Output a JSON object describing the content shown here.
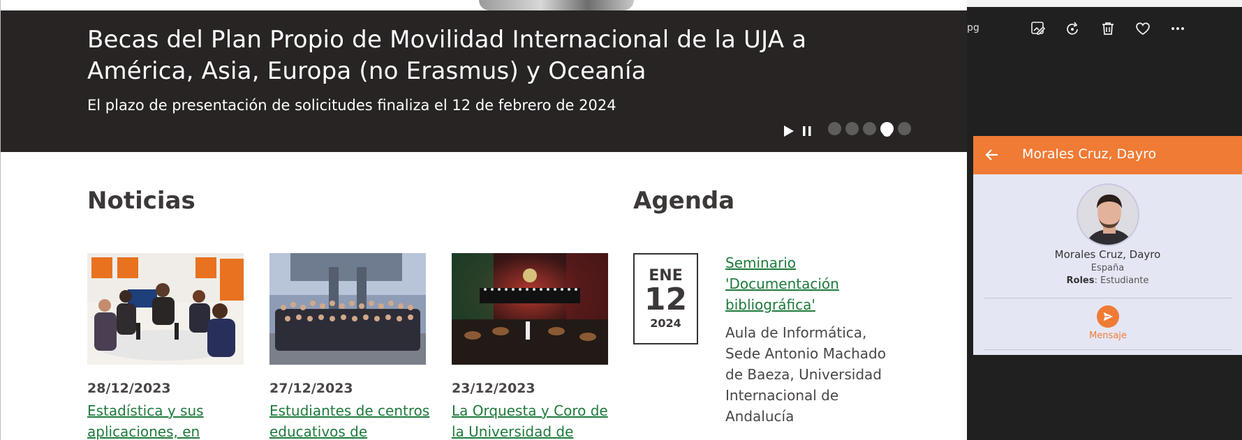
{
  "banner": {
    "title": "Becas del Plan Propio de Movilidad Internacional de la UJA a América, Asia, Europa (no Erasmus) y Oceanía",
    "subtitle": "El plazo de presentación de solicitudes finaliza el 12 de febrero de 2024",
    "slide_count": 5,
    "active_slide": 4
  },
  "news": {
    "heading": "Noticias",
    "items": [
      {
        "date": "28/12/2023",
        "title": "Estadística y sus aplicaciones, en"
      },
      {
        "date": "27/12/2023",
        "title": "Estudiantes de centros educativos de"
      },
      {
        "date": "23/12/2023",
        "title": "La Orquesta y Coro de la Universidad de"
      }
    ]
  },
  "agenda": {
    "heading": "Agenda",
    "month": "ENE",
    "day": "12",
    "year": "2024",
    "event_title": "Seminario 'Documentación bibliográfica'",
    "event_place": "Aula de Informática, Sede Antonio Machado de Baeza, Universidad Internacional de Andalucía"
  },
  "viewer": {
    "file_suffix": "pg",
    "icons": [
      "edit-image-icon",
      "rotate-icon",
      "delete-icon",
      "favorite-icon",
      "more-icon"
    ]
  },
  "contact_card": {
    "header_title": "Morales Cruz, Dayro",
    "name": "Morales Cruz, Dayro",
    "country": "España",
    "roles_label": "Roles",
    "roles_value": "Estudiante",
    "message_label": "Mensaje",
    "accent_color": "#ef7b35"
  }
}
